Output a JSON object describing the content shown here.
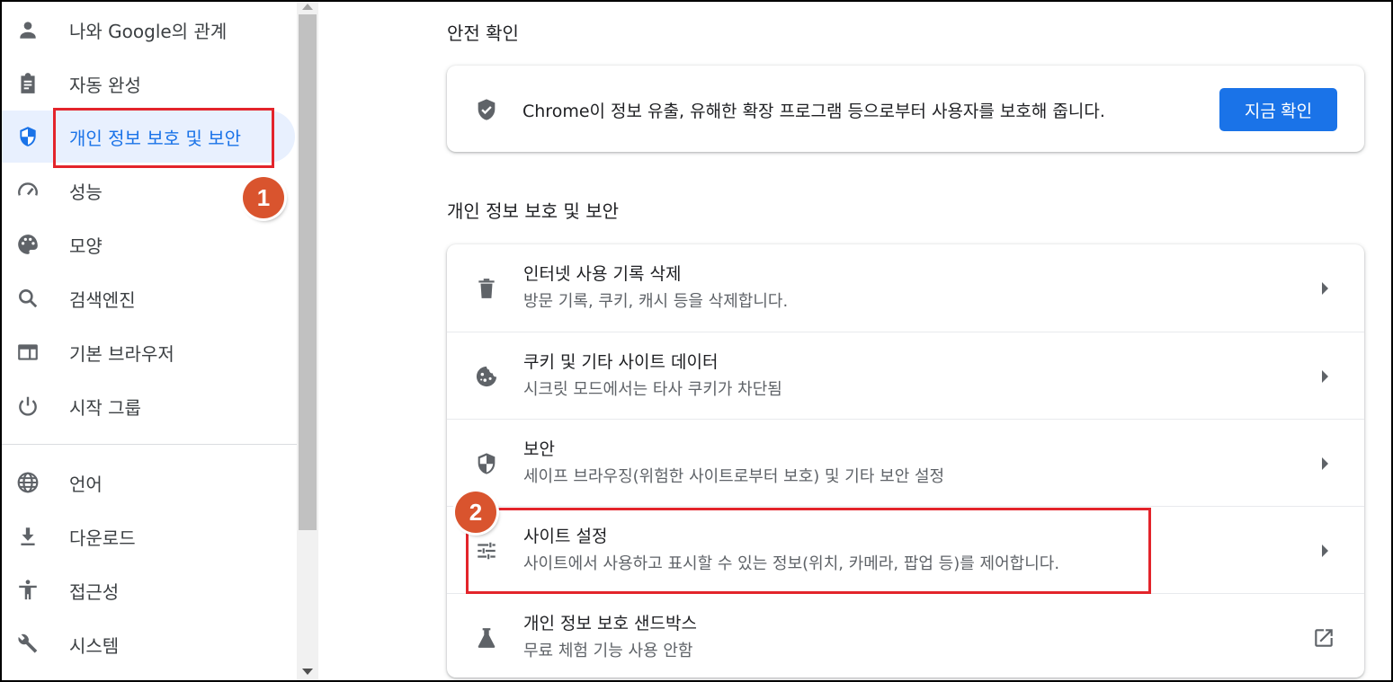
{
  "sidebar": {
    "items": [
      {
        "label": "나와 Google의 관계",
        "icon": "person-icon"
      },
      {
        "label": "자동 완성",
        "icon": "clipboard-icon"
      },
      {
        "label": "개인 정보 보호 및 보안",
        "icon": "shield-icon",
        "active": true
      },
      {
        "label": "성능",
        "icon": "speedometer-icon"
      },
      {
        "label": "모양",
        "icon": "palette-icon"
      },
      {
        "label": "검색엔진",
        "icon": "search-icon"
      },
      {
        "label": "기본 브라우저",
        "icon": "browser-window-icon"
      },
      {
        "label": "시작 그룹",
        "icon": "power-icon"
      },
      {
        "label": "언어",
        "icon": "globe-icon"
      },
      {
        "label": "다운로드",
        "icon": "download-icon"
      },
      {
        "label": "접근성",
        "icon": "accessibility-icon"
      },
      {
        "label": "시스템",
        "icon": "wrench-icon"
      }
    ]
  },
  "safety_check": {
    "section_title": "안전 확인",
    "description": "Chrome이 정보 유출, 유해한 확장 프로그램 등으로부터 사용자를 보호해 줍니다.",
    "button_label": "지금 확인"
  },
  "privacy": {
    "section_title": "개인 정보 보호 및 보안",
    "rows": [
      {
        "title": "인터넷 사용 기록 삭제",
        "subtitle": "방문 기록, 쿠키, 캐시 등을 삭제합니다.",
        "icon": "trash-icon"
      },
      {
        "title": "쿠키 및 기타 사이트 데이터",
        "subtitle": "시크릿 모드에서는 타사 쿠키가 차단됨",
        "icon": "cookie-icon"
      },
      {
        "title": "보안",
        "subtitle": "세이프 브라우징(위험한 사이트로부터 보호) 및 기타 보안 설정",
        "icon": "security-shield-icon"
      },
      {
        "title": "사이트 설정",
        "subtitle": "사이트에서 사용하고 표시할 수 있는 정보(위치, 카메라, 팝업 등)를 제어합니다.",
        "icon": "sliders-icon"
      },
      {
        "title": "개인 정보 보호 샌드박스",
        "subtitle": "무료 체험 기능 사용 안함",
        "icon": "flask-icon"
      }
    ]
  },
  "annotations": {
    "badge_1": "1",
    "badge_2": "2"
  },
  "colors": {
    "accent": "#1a73e8",
    "active_bg": "#e8f0fe",
    "highlight": "#e3242b",
    "badge": "#d9542e"
  }
}
